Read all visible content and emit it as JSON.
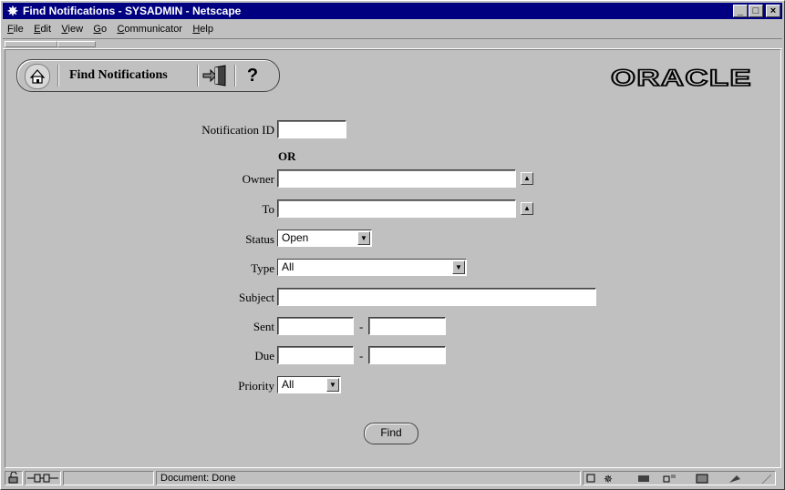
{
  "window": {
    "title": "Find Notifications - SYSADMIN - Netscape",
    "controls": [
      "_",
      "□",
      "×"
    ]
  },
  "menu": [
    "File",
    "Edit",
    "View",
    "Go",
    "Communicator",
    "Help"
  ],
  "toolbar": {
    "title": "Find Notifications",
    "help": "?"
  },
  "brand": "ORACLE",
  "form": {
    "notification_id_label": "Notification ID",
    "or_label": "OR",
    "owner_label": "Owner",
    "to_label": "To",
    "status_label": "Status",
    "status_value": "Open",
    "type_label": "Type",
    "type_value": "All",
    "subject_label": "Subject",
    "sent_label": "Sent",
    "due_label": "Due",
    "range_sep": "-",
    "priority_label": "Priority",
    "priority_value": "All",
    "find_label": "Find"
  },
  "status": {
    "text": "Document: Done"
  }
}
